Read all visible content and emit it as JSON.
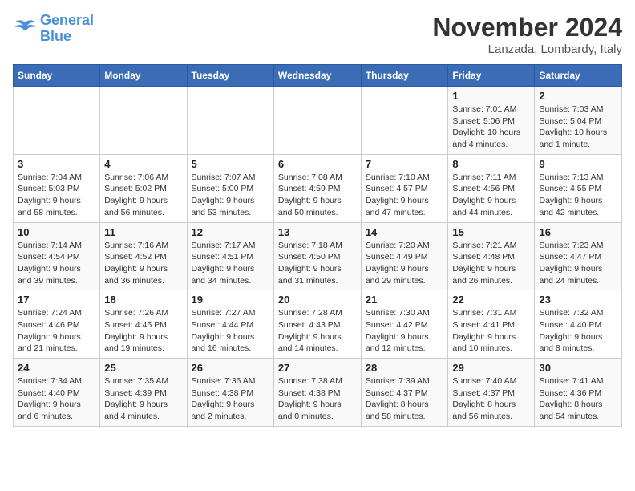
{
  "header": {
    "logo_line1": "General",
    "logo_line2": "Blue",
    "month_title": "November 2024",
    "location": "Lanzada, Lombardy, Italy"
  },
  "days_of_week": [
    "Sunday",
    "Monday",
    "Tuesday",
    "Wednesday",
    "Thursday",
    "Friday",
    "Saturday"
  ],
  "weeks": [
    [
      {
        "day": "",
        "info": ""
      },
      {
        "day": "",
        "info": ""
      },
      {
        "day": "",
        "info": ""
      },
      {
        "day": "",
        "info": ""
      },
      {
        "day": "",
        "info": ""
      },
      {
        "day": "1",
        "info": "Sunrise: 7:01 AM\nSunset: 5:06 PM\nDaylight: 10 hours\nand 4 minutes."
      },
      {
        "day": "2",
        "info": "Sunrise: 7:03 AM\nSunset: 5:04 PM\nDaylight: 10 hours\nand 1 minute."
      }
    ],
    [
      {
        "day": "3",
        "info": "Sunrise: 7:04 AM\nSunset: 5:03 PM\nDaylight: 9 hours\nand 58 minutes."
      },
      {
        "day": "4",
        "info": "Sunrise: 7:06 AM\nSunset: 5:02 PM\nDaylight: 9 hours\nand 56 minutes."
      },
      {
        "day": "5",
        "info": "Sunrise: 7:07 AM\nSunset: 5:00 PM\nDaylight: 9 hours\nand 53 minutes."
      },
      {
        "day": "6",
        "info": "Sunrise: 7:08 AM\nSunset: 4:59 PM\nDaylight: 9 hours\nand 50 minutes."
      },
      {
        "day": "7",
        "info": "Sunrise: 7:10 AM\nSunset: 4:57 PM\nDaylight: 9 hours\nand 47 minutes."
      },
      {
        "day": "8",
        "info": "Sunrise: 7:11 AM\nSunset: 4:56 PM\nDaylight: 9 hours\nand 44 minutes."
      },
      {
        "day": "9",
        "info": "Sunrise: 7:13 AM\nSunset: 4:55 PM\nDaylight: 9 hours\nand 42 minutes."
      }
    ],
    [
      {
        "day": "10",
        "info": "Sunrise: 7:14 AM\nSunset: 4:54 PM\nDaylight: 9 hours\nand 39 minutes."
      },
      {
        "day": "11",
        "info": "Sunrise: 7:16 AM\nSunset: 4:52 PM\nDaylight: 9 hours\nand 36 minutes."
      },
      {
        "day": "12",
        "info": "Sunrise: 7:17 AM\nSunset: 4:51 PM\nDaylight: 9 hours\nand 34 minutes."
      },
      {
        "day": "13",
        "info": "Sunrise: 7:18 AM\nSunset: 4:50 PM\nDaylight: 9 hours\nand 31 minutes."
      },
      {
        "day": "14",
        "info": "Sunrise: 7:20 AM\nSunset: 4:49 PM\nDaylight: 9 hours\nand 29 minutes."
      },
      {
        "day": "15",
        "info": "Sunrise: 7:21 AM\nSunset: 4:48 PM\nDaylight: 9 hours\nand 26 minutes."
      },
      {
        "day": "16",
        "info": "Sunrise: 7:23 AM\nSunset: 4:47 PM\nDaylight: 9 hours\nand 24 minutes."
      }
    ],
    [
      {
        "day": "17",
        "info": "Sunrise: 7:24 AM\nSunset: 4:46 PM\nDaylight: 9 hours\nand 21 minutes."
      },
      {
        "day": "18",
        "info": "Sunrise: 7:26 AM\nSunset: 4:45 PM\nDaylight: 9 hours\nand 19 minutes."
      },
      {
        "day": "19",
        "info": "Sunrise: 7:27 AM\nSunset: 4:44 PM\nDaylight: 9 hours\nand 16 minutes."
      },
      {
        "day": "20",
        "info": "Sunrise: 7:28 AM\nSunset: 4:43 PM\nDaylight: 9 hours\nand 14 minutes."
      },
      {
        "day": "21",
        "info": "Sunrise: 7:30 AM\nSunset: 4:42 PM\nDaylight: 9 hours\nand 12 minutes."
      },
      {
        "day": "22",
        "info": "Sunrise: 7:31 AM\nSunset: 4:41 PM\nDaylight: 9 hours\nand 10 minutes."
      },
      {
        "day": "23",
        "info": "Sunrise: 7:32 AM\nSunset: 4:40 PM\nDaylight: 9 hours\nand 8 minutes."
      }
    ],
    [
      {
        "day": "24",
        "info": "Sunrise: 7:34 AM\nSunset: 4:40 PM\nDaylight: 9 hours\nand 6 minutes."
      },
      {
        "day": "25",
        "info": "Sunrise: 7:35 AM\nSunset: 4:39 PM\nDaylight: 9 hours\nand 4 minutes."
      },
      {
        "day": "26",
        "info": "Sunrise: 7:36 AM\nSunset: 4:38 PM\nDaylight: 9 hours\nand 2 minutes."
      },
      {
        "day": "27",
        "info": "Sunrise: 7:38 AM\nSunset: 4:38 PM\nDaylight: 9 hours\nand 0 minutes."
      },
      {
        "day": "28",
        "info": "Sunrise: 7:39 AM\nSunset: 4:37 PM\nDaylight: 8 hours\nand 58 minutes."
      },
      {
        "day": "29",
        "info": "Sunrise: 7:40 AM\nSunset: 4:37 PM\nDaylight: 8 hours\nand 56 minutes."
      },
      {
        "day": "30",
        "info": "Sunrise: 7:41 AM\nSunset: 4:36 PM\nDaylight: 8 hours\nand 54 minutes."
      }
    ]
  ]
}
